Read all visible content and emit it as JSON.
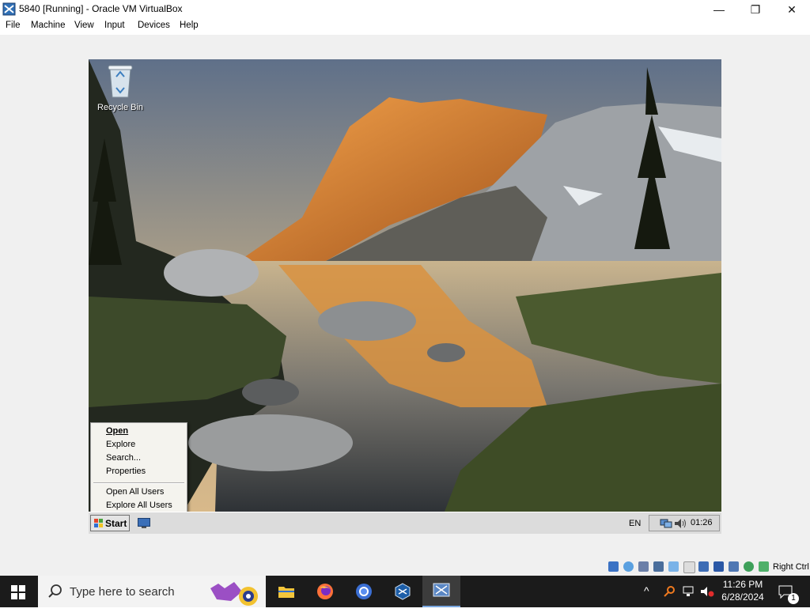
{
  "window": {
    "title": "5840 [Running] - Oracle VM VirtualBox",
    "controls": {
      "minimize": "—",
      "maximize": "❐",
      "close": "✕"
    }
  },
  "menu": [
    "File",
    "Machine",
    "View",
    "Input",
    "Devices",
    "Help"
  ],
  "guest": {
    "desktop_icon": {
      "label": "Recycle Bin",
      "icon": "recycle-bin-icon"
    },
    "context_menu": {
      "items": [
        "Open",
        "Explore",
        "Search...",
        "Properties"
      ],
      "items2": [
        "Open All Users",
        "Explore All Users"
      ],
      "default_item": "Open"
    },
    "taskbar": {
      "start_label": "Start",
      "language": "EN",
      "clock": "01:26"
    }
  },
  "vbox_status": {
    "host_key": "Right Ctrl"
  },
  "host_taskbar": {
    "search_placeholder": "Type here to search",
    "time": "11:26 PM",
    "date": "6/28/2024",
    "notification_count": "1"
  },
  "colors": {
    "host_taskbar": "#1b1b1b",
    "vm_border_bg": "#f0f0f0",
    "guest_taskbar": "#dcdcdc"
  }
}
